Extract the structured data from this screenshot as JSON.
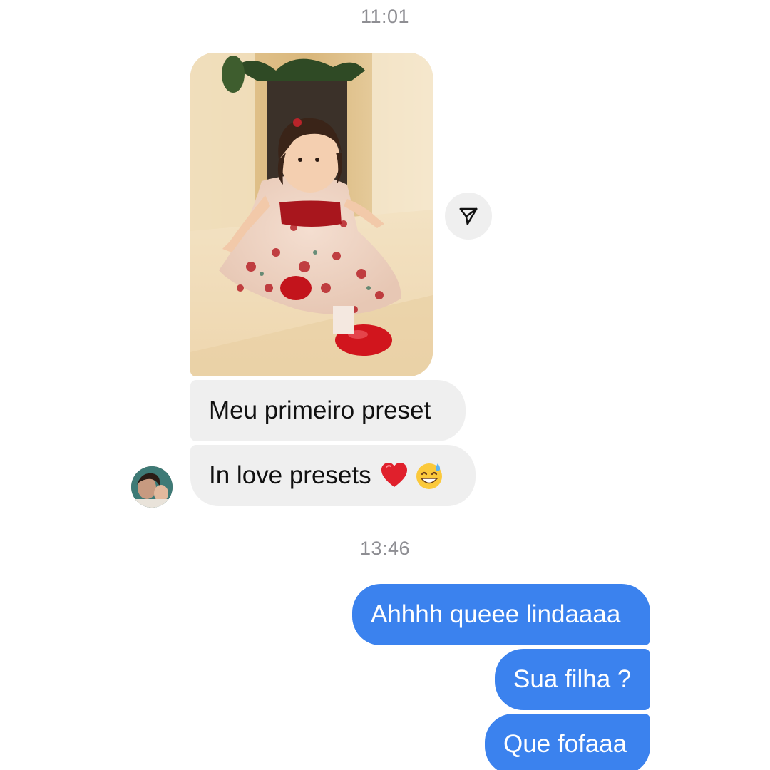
{
  "conversation": {
    "timestamps": [
      "11:01",
      "13:46"
    ],
    "incoming": [
      {
        "text": "Meu primeiro preset"
      },
      {
        "text": "In love presets",
        "emojis": [
          "red-heart",
          "grinning-sweat-face"
        ]
      }
    ],
    "outgoing": [
      {
        "text": "Ahhhh queee lindaaaa"
      },
      {
        "text": "Sua filha ?"
      },
      {
        "text": "Que fofaaa"
      }
    ]
  },
  "icons": {
    "share": "paper-plane-icon",
    "heart": "red-heart-icon",
    "face": "grinning-sweat-face-icon"
  },
  "colors": {
    "background": "#ffffff",
    "incoming_bubble": "#efefef",
    "outgoing_bubble": "#3b82ee",
    "timestamp": "#8e8e93",
    "heart": "#e0202c"
  }
}
